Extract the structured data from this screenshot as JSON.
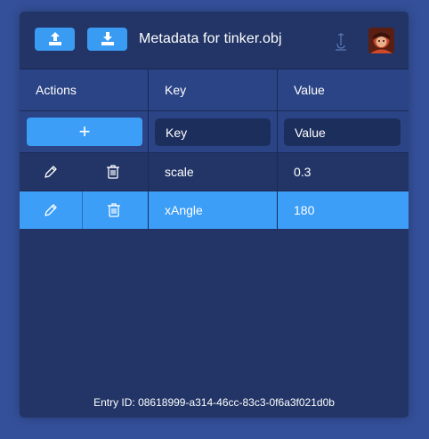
{
  "header": {
    "title": "Metadata for tinker.obj",
    "upload_icon": "upload-icon",
    "download_icon": "download-icon",
    "pin_icon": "pin-icon",
    "avatar_icon": "avatar"
  },
  "table": {
    "columns": [
      "Actions",
      "Key",
      "Value"
    ],
    "add_label": "+",
    "key_placeholder": "Key",
    "value_placeholder": "Value",
    "rows": [
      {
        "key": "scale",
        "value": "0.3",
        "selected": false
      },
      {
        "key": "xAngle",
        "value": "180",
        "selected": true
      }
    ]
  },
  "footer": {
    "entry_id": "Entry ID: 08618999-a314-46cc-83c3-0f6a3f021d0b"
  },
  "colors": {
    "background": "#34509a",
    "panel": "#223566",
    "header_row": "#2b4485",
    "accent": "#3d9ef7",
    "input": "#1c2e5c"
  }
}
